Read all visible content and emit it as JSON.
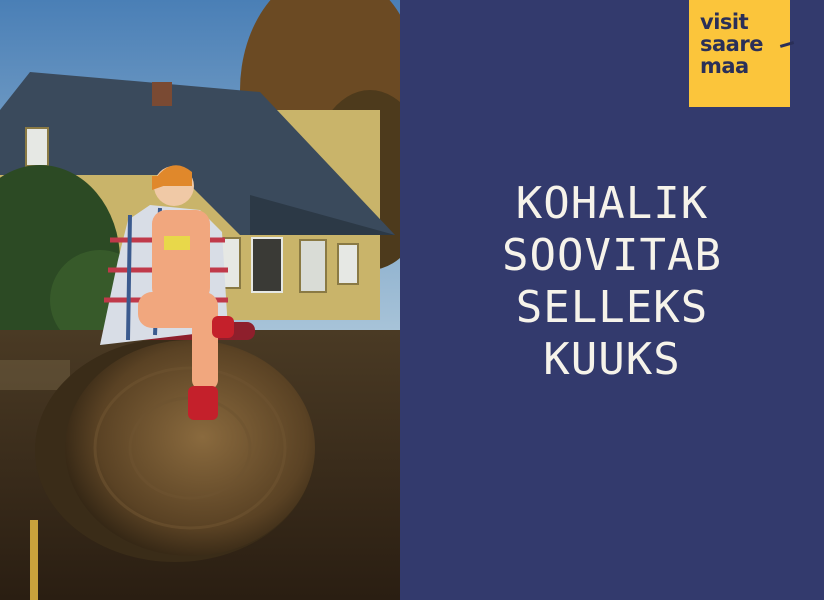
{
  "logo": {
    "lines": [
      "visit",
      "saare",
      "maa"
    ],
    "background": "#fbc53b",
    "text_color": "#2a2f58"
  },
  "headline": {
    "lines": [
      "KOHALIK",
      "SOOVITAB",
      "SELLEKS",
      "KUUKS"
    ],
    "color": "#f6f3ea"
  },
  "colors": {
    "panel_background": "#333a6d"
  }
}
